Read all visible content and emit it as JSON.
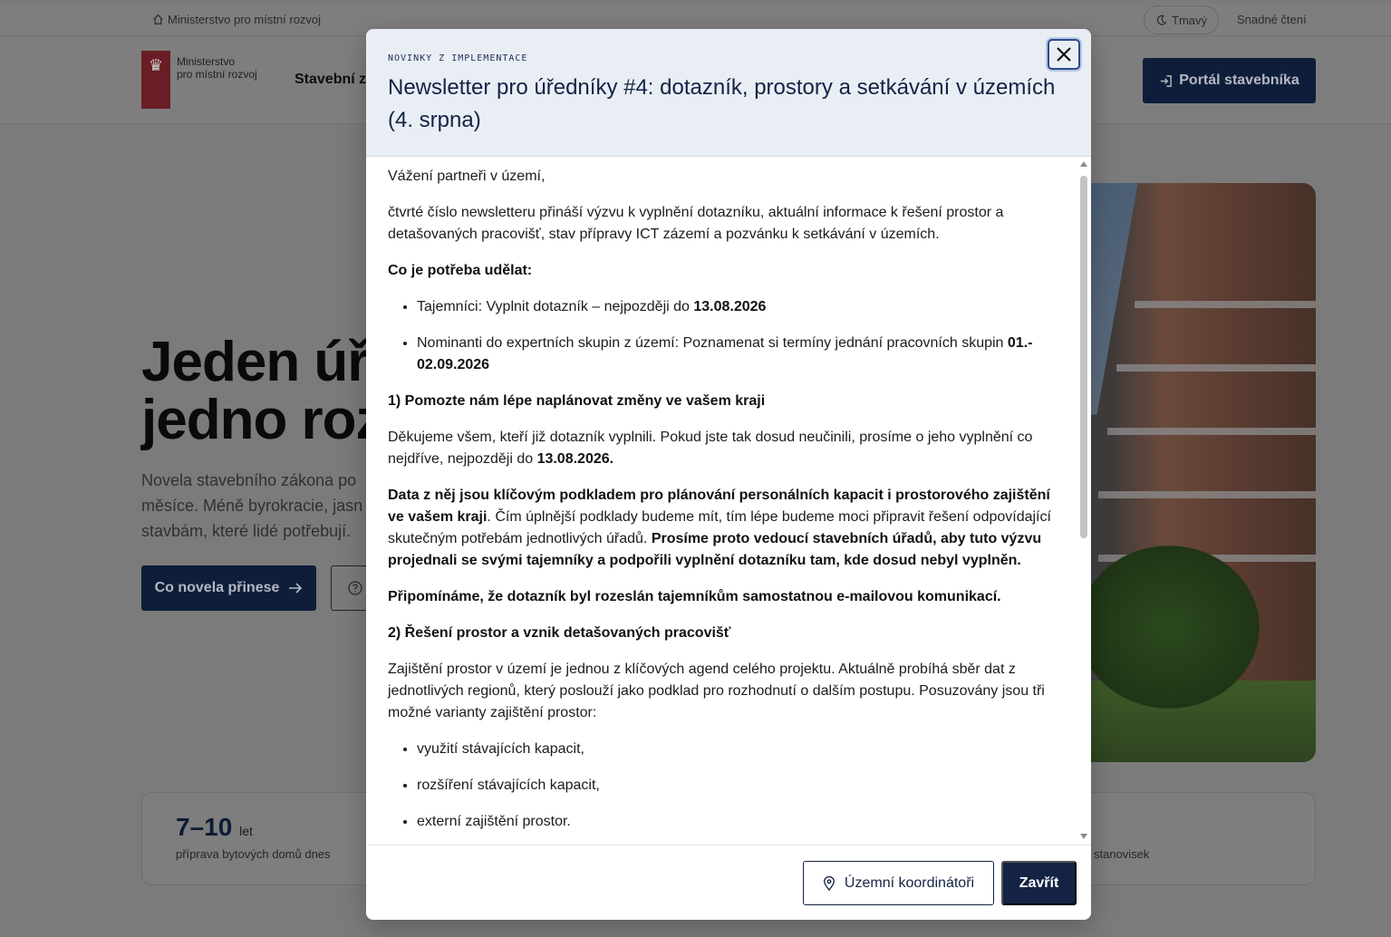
{
  "topbar": {
    "ministry_link": "Ministerstvo pro místní rozvoj",
    "dark_mode_label": "Tmavý",
    "easy_read_label": "Snadné čtení"
  },
  "header": {
    "logo_line1": "Ministerstvo",
    "logo_line2": "pro místní rozvoj",
    "nav_title": "Stavební z",
    "portal_button": "Portál stavebníka"
  },
  "hero": {
    "title_line1": "Jeden úřa",
    "title_line2": "jedno rozh",
    "text_line1": "Novela stavebního zákona po",
    "text_line2": "měsíce. Méně byrokracie, jasn",
    "text_line3": "stavbám, které lidé potřebují.",
    "cta_label": "Co novela přinese"
  },
  "stats": {
    "value": "7–10",
    "unit": "let",
    "label": "příprava bytových domů dnes",
    "label_right": "stanovisek"
  },
  "modal": {
    "kicker": "NOVINKY Z IMPLEMENTACE",
    "title": "Newsletter pro úředníky #4: dotazník, prostory a setkávání v územích (4. srpna)",
    "body": {
      "greeting": "Vážení partneři v území,",
      "intro": " čtvrté číslo newsletteru přináší výzvu k vyplnění dotazníku, aktuální informace k řešení prostor a detašovaných pracovišť, stav přípravy ICT zázemí a pozvánku k setkávání v územích.",
      "todo_heading": "Co je potřeba udělat:",
      "todo1_text": "Tajemníci: Vyplnit dotazník – nejpozději do ",
      "todo1_date": "13.08.2026",
      "todo2_text": "Nominanti do expertních skupin z území: Poznamenat si termíny jednání pracovních skupin ",
      "todo2_date": "01.- 02.09.2026",
      "s1_heading": "1) Pomozte nám lépe naplánovat změny ve vašem kraji",
      "s1_p1_text": "Děkujeme všem, kteří již dotazník vyplnili. Pokud jste tak dosud neučinili, prosíme o jeho vyplnění co nejdříve, nejpozději do ",
      "s1_p1_date": "13.08.2026.",
      "s1_p2_bold1": "Data z něj jsou klíčovým podkladem pro plánování personálních kapacit i prostorového zajištění ve vašem kraji",
      "s1_p2_text": ". Čím úplnější podklady budeme mít, tím lépe budeme moci připravit řešení odpovídající skutečným potřebám jednotlivých úřadů. ",
      "s1_p2_bold2": "Prosíme proto vedoucí stavebních úřadů, aby tuto výzvu projednali se svými tajemníky a podpořili vyplnění dotazníku tam, kde dosud nebyl vyplněn.",
      "s1_p3": "Připomínáme, že dotazník byl rozeslán tajemníkům samostatnou e-mailovou komunikací.",
      "s2_heading": "2) Řešení prostor a vznik detašovaných pracovišť",
      "s2_p1": " Zajištění prostor v území je jednou z klíčových agend celého projektu. Aktuálně probíhá sběr dat z jednotlivých regionů, který poslouží jako podklad pro rozhodnutí o dalším postupu. Posuzovány jsou tři možné varianty zajištění prostor:",
      "s2_li1": " využití stávajících kapacit,",
      "s2_li2": " rozšíření stávajících kapacit,",
      "s2_li3": "externí zajištění prostor."
    },
    "coordinators_button": "Územní koordinátoři",
    "close_button": "Zavřít"
  }
}
